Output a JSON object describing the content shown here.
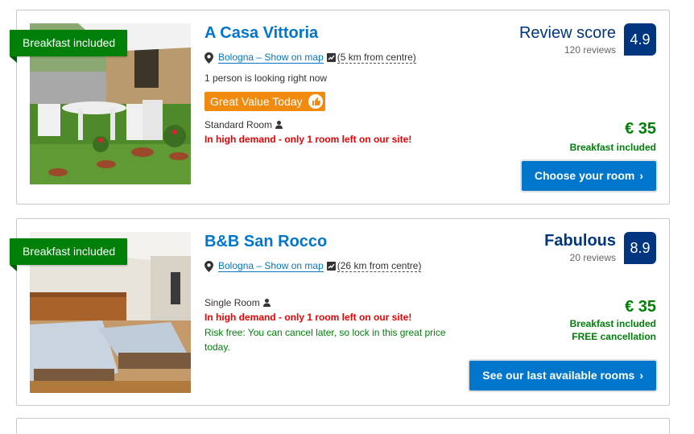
{
  "listings": [
    {
      "ribbon": "Breakfast included",
      "name": "A Casa Vittoria",
      "location_link": "Bologna – Show on map",
      "distance": "(5 km from centre)",
      "looking": "1 person is looking right now",
      "badge": "Great Value Today",
      "room_type": "Standard Room",
      "demand": "In high demand - only 1 room left on our site!",
      "score_label": "Review score",
      "reviews": "120 reviews",
      "score": "4.9",
      "price": "€ 35",
      "meal": "Breakfast included",
      "cta": "Choose your room",
      "chevron": "›"
    },
    {
      "ribbon": "Breakfast included",
      "name": "B&B San Rocco",
      "location_link": "Bologna – Show on map",
      "distance": "(26 km from centre)",
      "room_type": "Single Room",
      "demand": "In high demand - only 1 room left on our site!",
      "risk_free": "Risk free: You can cancel later, so lock in this great price today.",
      "score_label": "Fabulous",
      "reviews": "20 reviews",
      "score": "8.9",
      "price": "€ 35",
      "meal": "Breakfast included",
      "cancellation": "FREE cancellation",
      "cta": "See our last available rooms",
      "chevron": "›"
    }
  ],
  "icons": {
    "pin": "map-pin-icon",
    "map": "map-icon",
    "person": "person-icon",
    "thumb": "thumbs-up-icon"
  },
  "colors": {
    "brand_blue": "#003580",
    "link_blue": "#0077cc",
    "green": "#008009",
    "orange": "#f08b0f",
    "red": "#e00000"
  }
}
